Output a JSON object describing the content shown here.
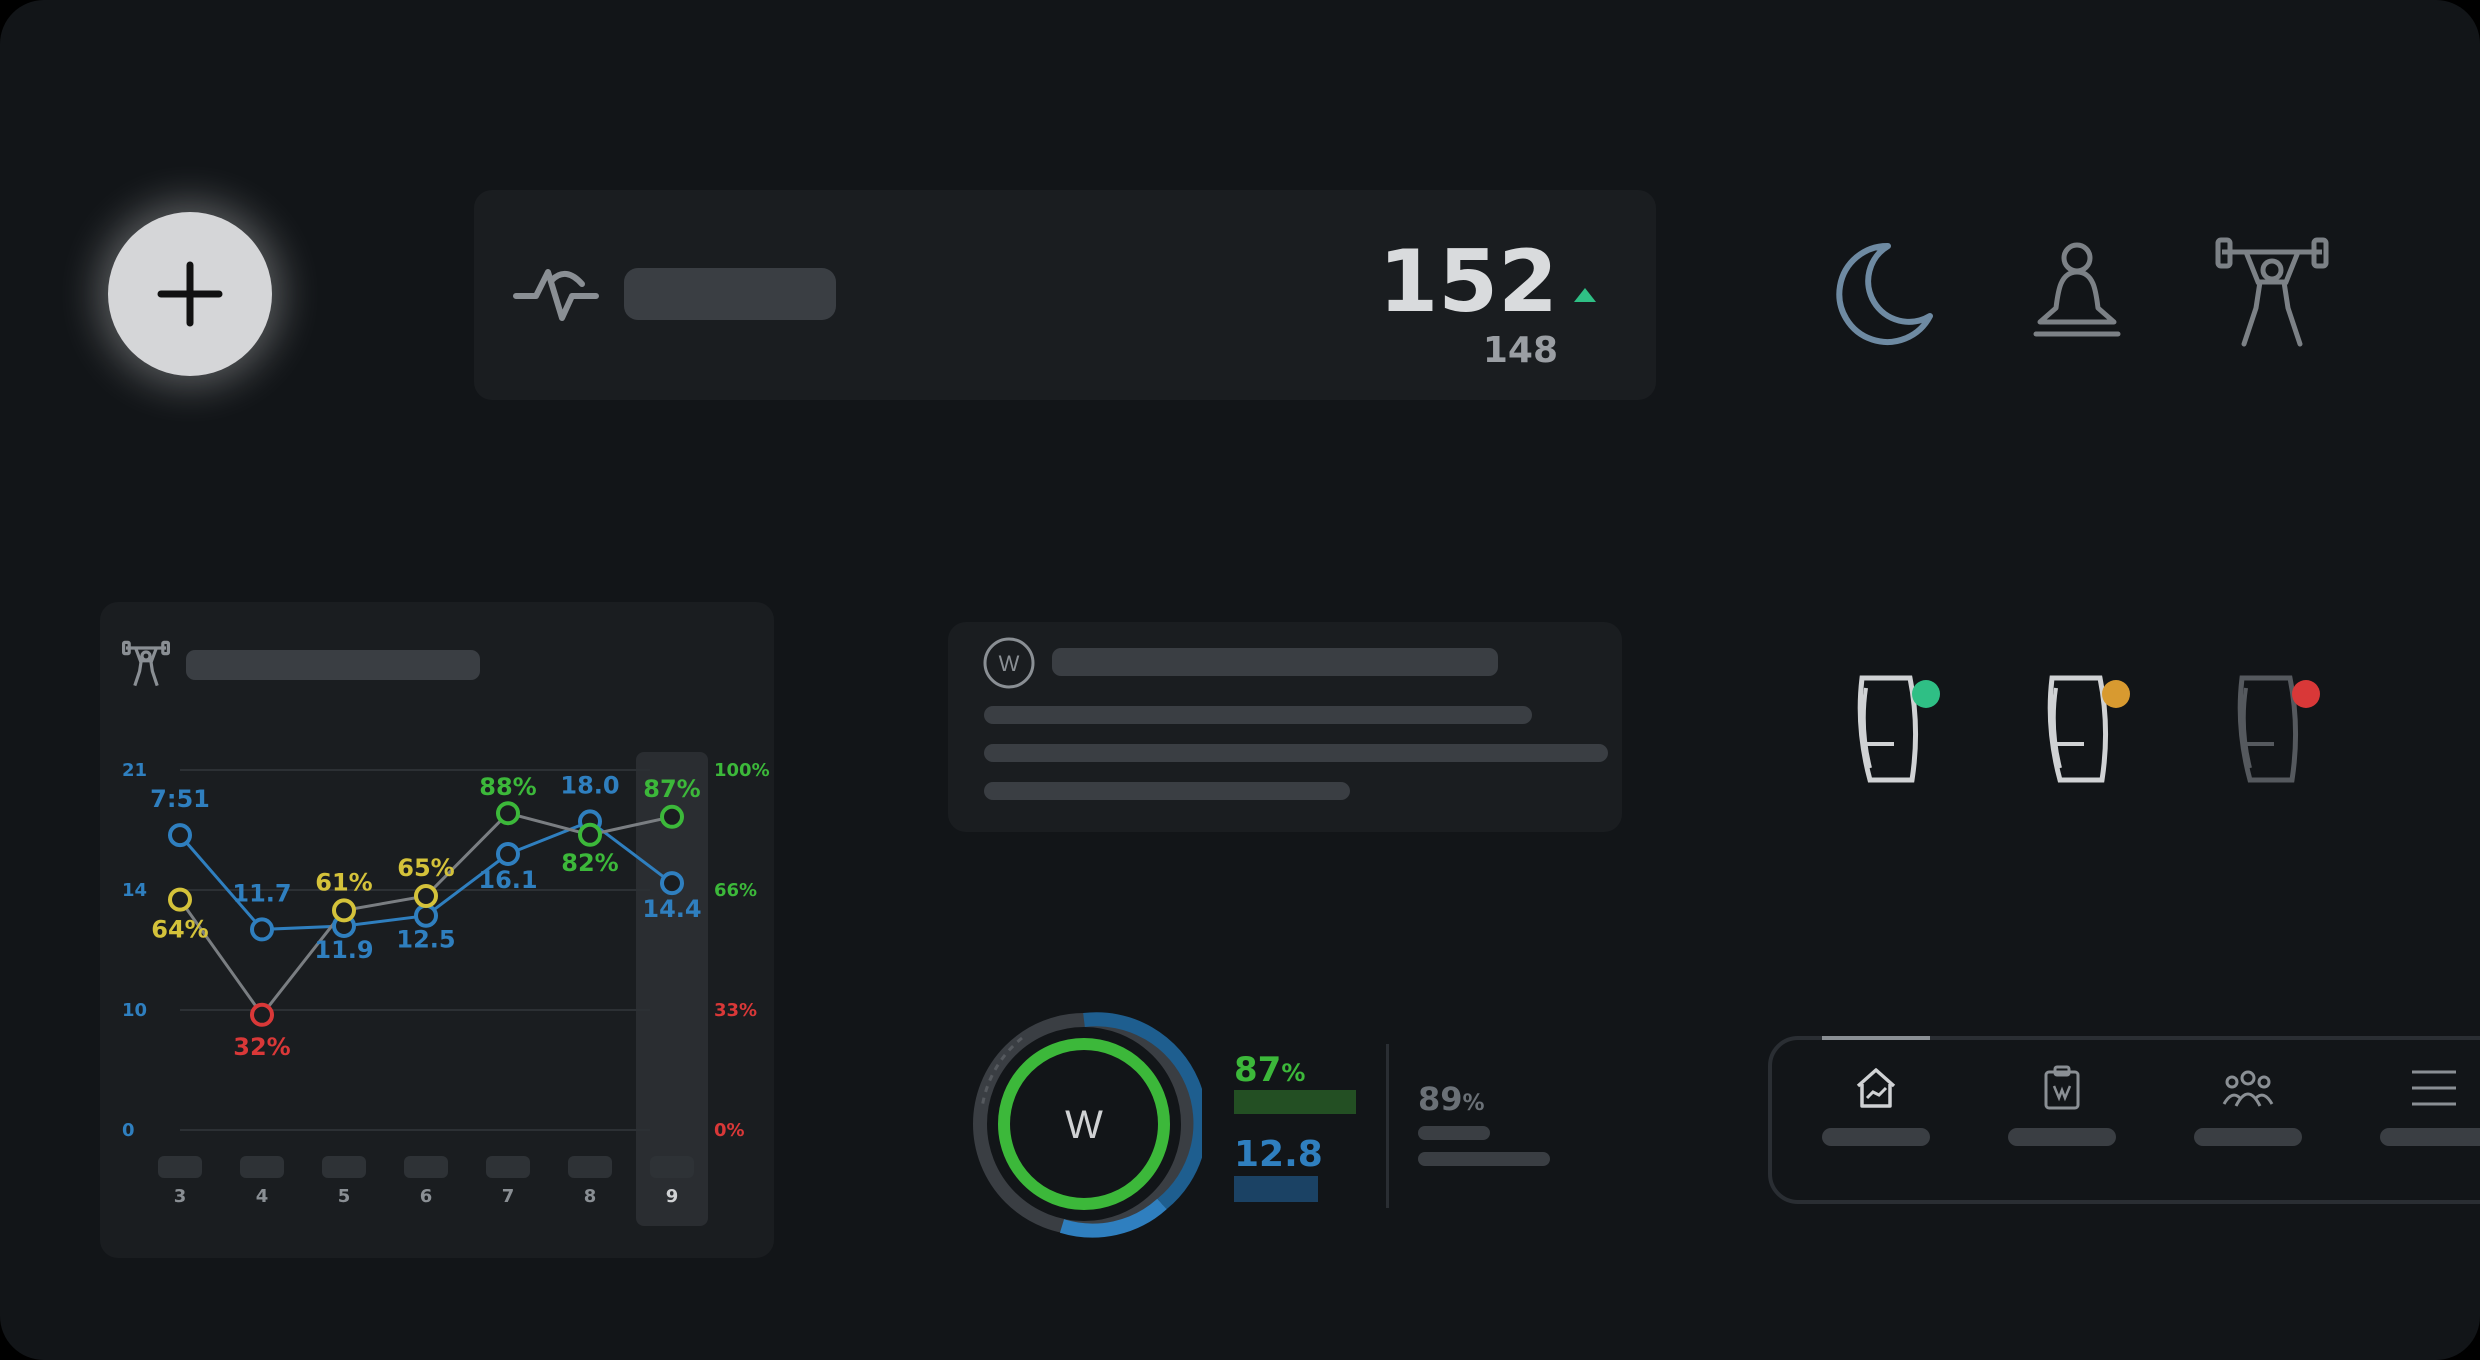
{
  "add_button": {
    "icon": "plus-icon"
  },
  "heart_rate": {
    "icon": "heartbeat-icon",
    "value": "152",
    "previous": "148",
    "trend": "up",
    "trend_color": "#2fbf85"
  },
  "activity_icons": [
    "moon-icon",
    "meditation-icon",
    "weightlifting-icon"
  ],
  "devices": [
    {
      "icon": "wristband-icon",
      "status_color": "#2fbf85"
    },
    {
      "icon": "wristband-icon",
      "status_color": "#d89a30"
    },
    {
      "icon": "wristband-icon",
      "status_color": "#d93838"
    }
  ],
  "workout_card": {
    "icon": "weightlifting-icon"
  },
  "message_card": {
    "logo": "W"
  },
  "ring": {
    "logo": "W",
    "percent_a": "87",
    "value_b": "12.8",
    "percent_c": "89",
    "unit": "%"
  },
  "nav": {
    "items": [
      "home-chart-icon",
      "clipboard-icon",
      "group-icon",
      "menu-icon"
    ]
  },
  "chart_data": {
    "type": "line",
    "categories": [
      "3",
      "4",
      "5",
      "6",
      "7",
      "8",
      "9"
    ],
    "highlighted_category": "9",
    "left_axis": {
      "ticks": [
        "0",
        "10",
        "14",
        "21"
      ]
    },
    "right_axis": {
      "ticks": [
        "0%",
        "33%",
        "66%",
        "100%"
      ]
    },
    "series": [
      {
        "color": "#2f7fbf",
        "values": [
          17.2,
          11.7,
          11.9,
          12.5,
          16.1,
          18.0,
          14.4
        ],
        "labels": [
          "7:51",
          "11.7",
          "11.9",
          "12.5",
          "16.1",
          "18.0",
          "14.4"
        ]
      },
      {
        "values": [
          64,
          32,
          61,
          65,
          88,
          82,
          87
        ],
        "labels": [
          "64%",
          "32%",
          "61%",
          "65%",
          "88%",
          "82%",
          "87%"
        ],
        "point_colors": [
          "#d4c23a",
          "#d93838",
          "#d4c23a",
          "#d4c23a",
          "#3cb83a",
          "#3cb83a",
          "#3cb83a"
        ]
      }
    ],
    "grid": true
  }
}
